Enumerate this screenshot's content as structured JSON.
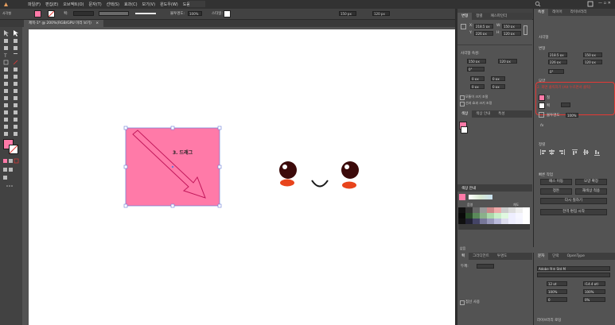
{
  "menubar": {
    "items": [
      "파일(F)",
      "편집(E)",
      "오브젝트(O)",
      "문자(T)",
      "선택(S)",
      "효과(C)",
      "보기(V)",
      "윈도우(W)",
      "도움말(H)"
    ]
  },
  "controlbar": {
    "stroke_label": "획:",
    "style_value": "균등",
    "basic_label": "기본",
    "opacity_label": "불투명도:",
    "opacity_value": "100%",
    "style_label": "스타일:",
    "w_value": "150 px",
    "h_value": "120 px"
  },
  "document_tab": {
    "title": "제목-1* @ 200%(RGB/GPU 미리 보기)",
    "close": "×"
  },
  "canvas": {
    "annotation": "3. 드래그",
    "fill_color": "#ff7aa8",
    "selection_color": "#6a7cd8",
    "arrow_color": "#c2185b"
  },
  "transform_panel": {
    "tabs": [
      "변형",
      "정렬",
      "패스파인더"
    ],
    "x_label": "X:",
    "x_value": "218.5 px",
    "y_label": "Y:",
    "y_value": "226 px",
    "w_label": "W:",
    "w_value": "150 px",
    "h_label": "H:",
    "h_value": "120 px",
    "rect_section": "사각형 속성:",
    "rw_value": "150 px",
    "rh_value": "120 px",
    "angle_value": "0°",
    "radius_a": "0 px",
    "radius_b": "0 px",
    "radius_c": "0 px",
    "radius_d": "0 px",
    "check1": "모퉁이 크기 조절",
    "check2": "선과 효과 크기 조정"
  },
  "color_panel": {
    "tabs": [
      "색상",
      "색상 안내",
      "특성"
    ],
    "guide_title": "색상 안내",
    "tone_left": "음영",
    "tone_right": "채도",
    "bottom_label": "없음"
  },
  "stroke_panel": {
    "tabs": [
      "획",
      "그라디언트",
      "투명도"
    ],
    "weight_label": "두께:",
    "check": "점선 사용"
  },
  "properties_panel": {
    "tabs": [
      "속성",
      "레이어",
      "라이브러리"
    ],
    "section_object": "사각형",
    "section_transform": "변형",
    "x_value": "218.5 px",
    "y_value": "226 px",
    "w_value": "150 px",
    "h_value": "120 px",
    "angle_value": "0°",
    "section_appearance": "모양",
    "annotation": "2. 화면 클릭하기 (Alt 누르면서 클릭)",
    "fill_label": "칠",
    "stroke_label": "획",
    "opacity_label": "불투명도",
    "opacity_value": "100%",
    "fx_label": "fx",
    "section_align": "정렬",
    "section_quick": "빠른 작업",
    "btn_offset": "패스 이동",
    "btn_expand": "모양 확장",
    "btn_arrange": "정돈",
    "btn_recolor": "재색상 적용",
    "btn_rearrange": "다시 칠하기",
    "btn_select_same": "전역 편집 시작"
  },
  "character_panel": {
    "tabs": [
      "문자",
      "단락",
      "OpenType"
    ],
    "font": "Adobe 명조 Std M",
    "size_value": "12 pt",
    "leading_value": "(14.4 pt)",
    "scale_v": "100%",
    "scale_h": "100%",
    "track_value": "0",
    "kern_value": "0%",
    "bottom_label": "라이브러리 로딩"
  },
  "colors": {
    "pink": "#ff7aa8",
    "eye_dark": "#3c0a0a",
    "cheek": "#e8441c",
    "annotation_red": "#e53935",
    "panel_bg": "#535353",
    "menubar_bg": "#323232"
  },
  "icons": {
    "logo": "illustrator-logo-icon",
    "arrange": "arrange-documents-icon",
    "search": "search-icon"
  }
}
